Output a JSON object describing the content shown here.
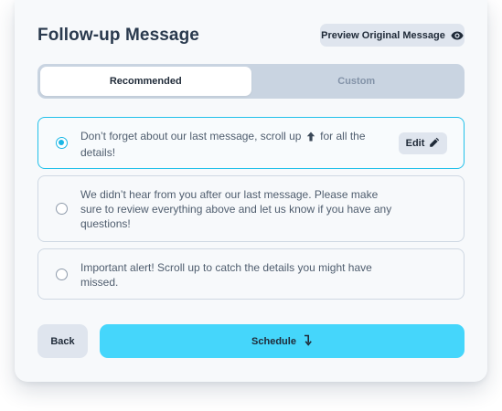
{
  "header": {
    "title": "Follow-up Message",
    "preview_label": "Preview Original Message",
    "preview_icon": "eye-icon"
  },
  "tabs": [
    {
      "label": "Recommended",
      "active": true
    },
    {
      "label": "Custom",
      "active": false
    }
  ],
  "options": [
    {
      "text_before_icon": "Don’t forget about our last message, scroll up",
      "inline_icon": "arrow-up-icon",
      "text_after_icon": "for all the",
      "text_line2": "details!",
      "selected": true,
      "edit_label": "Edit",
      "edit_icon": "pencil-icon"
    },
    {
      "line1": "We didn’t hear from you after our last message. Please make",
      "line2": "sure to review everything above and let us know if you have any",
      "line3": "questions!",
      "selected": false
    },
    {
      "line1": "Important alert! Scroll up to catch the details you might have",
      "line2": "missed.",
      "selected": false
    }
  ],
  "footer": {
    "back_label": "Back",
    "schedule_label": "Schedule",
    "schedule_icon": "turn-down-arrow-icon"
  },
  "colors": {
    "accent": "#45d6fb",
    "selected_border": "#22c0ea",
    "radio_on": "#1bb7e6",
    "button_gray": "#dfe5ee",
    "segment_bg": "#c9d4e1"
  }
}
